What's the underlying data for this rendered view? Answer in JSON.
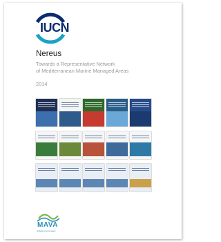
{
  "cover": {
    "publisher_logo": "IUCN",
    "title": "Nereus",
    "subtitle_lines": [
      "Towards a Representative Network",
      "of Mediterranean Marine Managed Areas"
    ],
    "year": "2014",
    "funder_logo": "MAVA",
    "funder_tagline": "fondation pour la nature"
  },
  "thumbnails": [
    {
      "name": "report-cover-1",
      "bg": "#1f2f55",
      "band": "#3c6fae"
    },
    {
      "name": "report-cover-2",
      "bg": "#f4f4f4",
      "band": "#2f5b8c"
    },
    {
      "name": "report-cover-3",
      "bg": "#2d6a2a",
      "band": "#c73a2f"
    },
    {
      "name": "report-cover-4",
      "bg": "#2a5e8a",
      "band": "#6aa8d8"
    },
    {
      "name": "report-cover-5",
      "bg": "#264b8a",
      "band": "#1a3a70"
    },
    {
      "name": "report-cover-6",
      "bg": "#f6f6f6",
      "band": "#3a7d3a"
    },
    {
      "name": "report-cover-7",
      "bg": "#f6f6f6",
      "band": "#6a8a3a"
    },
    {
      "name": "report-cover-8",
      "bg": "#f6f6f6",
      "band": "#b9523a"
    },
    {
      "name": "report-cover-9",
      "bg": "#f6f6f6",
      "band": "#3f6a9c"
    },
    {
      "name": "report-cover-10",
      "bg": "#f6f6f6",
      "band": "#2e7aa6"
    },
    {
      "name": "report-cover-11",
      "bg": "#e9eef4",
      "band": "#5d86b4"
    },
    {
      "name": "report-cover-12",
      "bg": "#e9eef4",
      "band": "#5d86b4"
    },
    {
      "name": "report-cover-13",
      "bg": "#e9eef4",
      "band": "#5d86b4"
    },
    {
      "name": "report-cover-14",
      "bg": "#e9eef4",
      "band": "#5d86b4"
    },
    {
      "name": "report-cover-15",
      "bg": "#e9eef4",
      "band": "#c9a14a"
    }
  ],
  "colors": {
    "iucn_blue": "#0a2c6e",
    "iucn_teal": "#1aa3c4",
    "mava_blue": "#2a8fb5",
    "mava_green": "#7ab648"
  }
}
